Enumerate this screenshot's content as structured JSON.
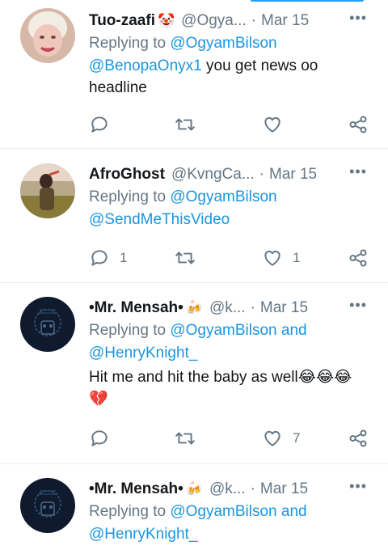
{
  "tweets": [
    {
      "name": "Tuo-zaafi",
      "badge": "🤡",
      "handle": "@Ogya...",
      "date": "Mar 15",
      "replying_prefix": "Replying to",
      "replying_to": "@OgyamBilson",
      "replying_and": "",
      "replying_to2": "",
      "mention": "@BenopaOnyx1",
      "text": " you get news oo headline",
      "reply_count": "",
      "retweet_count": "",
      "like_count": ""
    },
    {
      "name": "AfroGhost",
      "badge": "",
      "handle": "@KvngCa...",
      "date": "Mar 15",
      "replying_prefix": "Replying to",
      "replying_to": "@OgyamBilson",
      "replying_and": "",
      "replying_to2": "",
      "mention": "@SendMeThisVideo",
      "text": "",
      "reply_count": "1",
      "retweet_count": "",
      "like_count": "1"
    },
    {
      "name": "•Mr. Mensah•",
      "badge": "🍻",
      "handle": "@k...",
      "date": "Mar 15",
      "replying_prefix": "Replying to",
      "replying_to": "@OgyamBilson",
      "replying_and": "and",
      "replying_to2": "@HenryKnight_",
      "mention": "",
      "text": "Hit me and hit the baby as well😂😂😂💔",
      "reply_count": "",
      "retweet_count": "",
      "like_count": "7"
    },
    {
      "name": "•Mr. Mensah•",
      "badge": "🍻",
      "handle": "@k...",
      "date": "Mar 15",
      "replying_prefix": "Replying to",
      "replying_to": "@OgyamBilson",
      "replying_and": "and",
      "replying_to2": "@HenryKnight_",
      "mention": "",
      "text": "",
      "reply_count": "",
      "retweet_count": "",
      "like_count": ""
    }
  ],
  "more_glyph": "•••",
  "colors": {
    "link": "#1b95e0",
    "muted": "#657786",
    "border": "#e6ecf0"
  }
}
